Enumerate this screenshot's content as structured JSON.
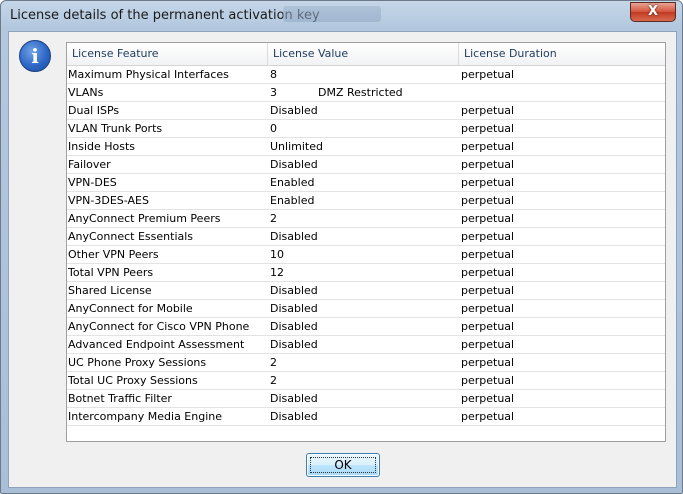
{
  "window": {
    "title": "License details of the permanent activation key",
    "close_label": "X"
  },
  "icons": {
    "info": "info-icon"
  },
  "table": {
    "headers": [
      "License Feature",
      "License Value",
      "License Duration"
    ],
    "rows": [
      {
        "feature": "Maximum Physical Interfaces",
        "value": "8",
        "extra": "",
        "duration": "perpetual"
      },
      {
        "feature": "VLANs",
        "value": "3",
        "extra": "DMZ Restricted",
        "duration": ""
      },
      {
        "feature": "Dual ISPs",
        "value": "Disabled",
        "extra": "",
        "duration": "perpetual"
      },
      {
        "feature": "VLAN Trunk Ports",
        "value": "0",
        "extra": "",
        "duration": "perpetual"
      },
      {
        "feature": "Inside Hosts",
        "value": "Unlimited",
        "extra": "",
        "duration": "perpetual"
      },
      {
        "feature": "Failover",
        "value": "Disabled",
        "extra": "",
        "duration": "perpetual"
      },
      {
        "feature": "VPN-DES",
        "value": "Enabled",
        "extra": "",
        "duration": "perpetual"
      },
      {
        "feature": "VPN-3DES-AES",
        "value": "Enabled",
        "extra": "",
        "duration": "perpetual"
      },
      {
        "feature": "AnyConnect Premium Peers",
        "value": "2",
        "extra": "",
        "duration": "perpetual"
      },
      {
        "feature": "AnyConnect Essentials",
        "value": "Disabled",
        "extra": "",
        "duration": "perpetual"
      },
      {
        "feature": "Other VPN Peers",
        "value": "10",
        "extra": "",
        "duration": "perpetual"
      },
      {
        "feature": "Total VPN Peers",
        "value": "12",
        "extra": "",
        "duration": "perpetual"
      },
      {
        "feature": "Shared License",
        "value": "Disabled",
        "extra": "",
        "duration": "perpetual"
      },
      {
        "feature": "AnyConnect for Mobile",
        "value": "Disabled",
        "extra": "",
        "duration": "perpetual"
      },
      {
        "feature": "AnyConnect for Cisco VPN Phone",
        "value": "Disabled",
        "extra": "",
        "duration": "perpetual"
      },
      {
        "feature": "Advanced Endpoint Assessment",
        "value": "Disabled",
        "extra": "",
        "duration": "perpetual"
      },
      {
        "feature": "UC Phone Proxy Sessions",
        "value": "2",
        "extra": "",
        "duration": "perpetual"
      },
      {
        "feature": "Total UC Proxy Sessions",
        "value": "2",
        "extra": "",
        "duration": "perpetual"
      },
      {
        "feature": "Botnet Traffic Filter",
        "value": "Disabled",
        "extra": "",
        "duration": "perpetual"
      },
      {
        "feature": "Intercompany Media Engine",
        "value": "Disabled",
        "extra": "",
        "duration": "perpetual"
      }
    ]
  },
  "buttons": {
    "ok_label": "OK"
  }
}
